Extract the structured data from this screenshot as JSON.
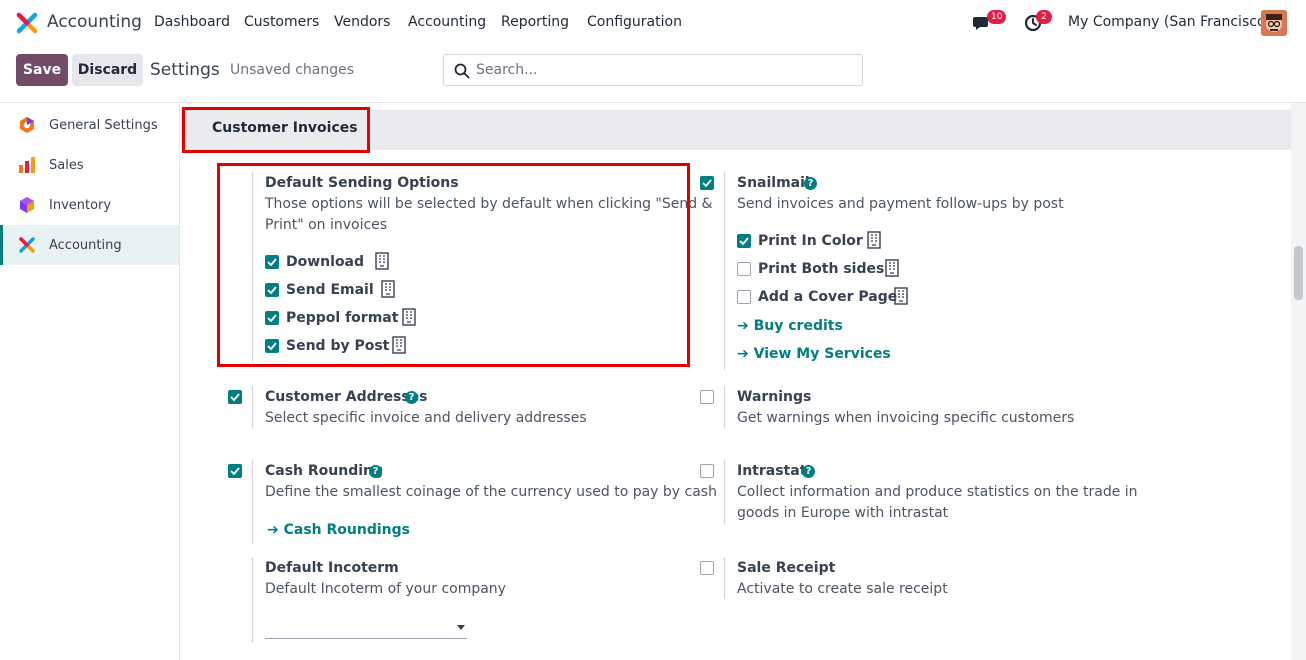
{
  "nav": {
    "app_name": "Accounting",
    "menu": [
      "Dashboard",
      "Customers",
      "Vendors",
      "Accounting",
      "Reporting",
      "Configuration"
    ],
    "messages_badge": "10",
    "activities_badge": "2",
    "company": "My Company (San Francisco)"
  },
  "control": {
    "save": "Save",
    "discard": "Discard",
    "title": "Settings",
    "unsaved": "Unsaved changes",
    "search_placeholder": "Search..."
  },
  "sidebar": {
    "items": [
      {
        "label": "General Settings",
        "icon": "general-settings-icon"
      },
      {
        "label": "Sales",
        "icon": "sales-icon"
      },
      {
        "label": "Inventory",
        "icon": "inventory-icon"
      },
      {
        "label": "Accounting",
        "icon": "accounting-icon",
        "active": true
      }
    ]
  },
  "section": {
    "title": "Customer Invoices"
  },
  "settings": {
    "default_sending": {
      "title": "Default Sending Options",
      "desc_line1": "Those options will be selected by default when clicking \"Send &",
      "desc_line2": "Print\" on invoices",
      "options": [
        {
          "label": "Download",
          "checked": true
        },
        {
          "label": "Send Email",
          "checked": true
        },
        {
          "label": "Peppol format",
          "checked": true
        },
        {
          "label": "Send by Post",
          "checked": true
        }
      ]
    },
    "snailmail": {
      "title": "Snailmail",
      "checked": true,
      "desc": "Send invoices and payment follow-ups by post",
      "options": [
        {
          "label": "Print In Color",
          "checked": true
        },
        {
          "label": "Print Both sides",
          "checked": false
        },
        {
          "label": "Add a Cover Page",
          "checked": false
        }
      ],
      "link_buy": "Buy credits",
      "link_services": "View My Services"
    },
    "customer_addresses": {
      "title": "Customer Addresses",
      "checked": true,
      "desc": "Select specific invoice and delivery addresses"
    },
    "warnings": {
      "title": "Warnings",
      "checked": false,
      "desc": "Get warnings when invoicing specific customers"
    },
    "cash_rounding": {
      "title": "Cash Rounding",
      "checked": true,
      "desc": "Define the smallest coinage of the currency used to pay by cash",
      "link": "Cash Roundings"
    },
    "intrastat": {
      "title": "Intrastat",
      "checked": false,
      "desc_line1": "Collect information and produce statistics on the trade in",
      "desc_line2": "goods in Europe with intrastat"
    },
    "default_incoterm": {
      "title": "Default Incoterm",
      "desc": "Default Incoterm of your company",
      "value": ""
    },
    "sale_receipt": {
      "title": "Sale Receipt",
      "checked": false,
      "desc": "Activate to create sale receipt"
    }
  },
  "colors": {
    "primary": "#714b67",
    "accent": "#017e84",
    "highlight": "#e00000"
  }
}
